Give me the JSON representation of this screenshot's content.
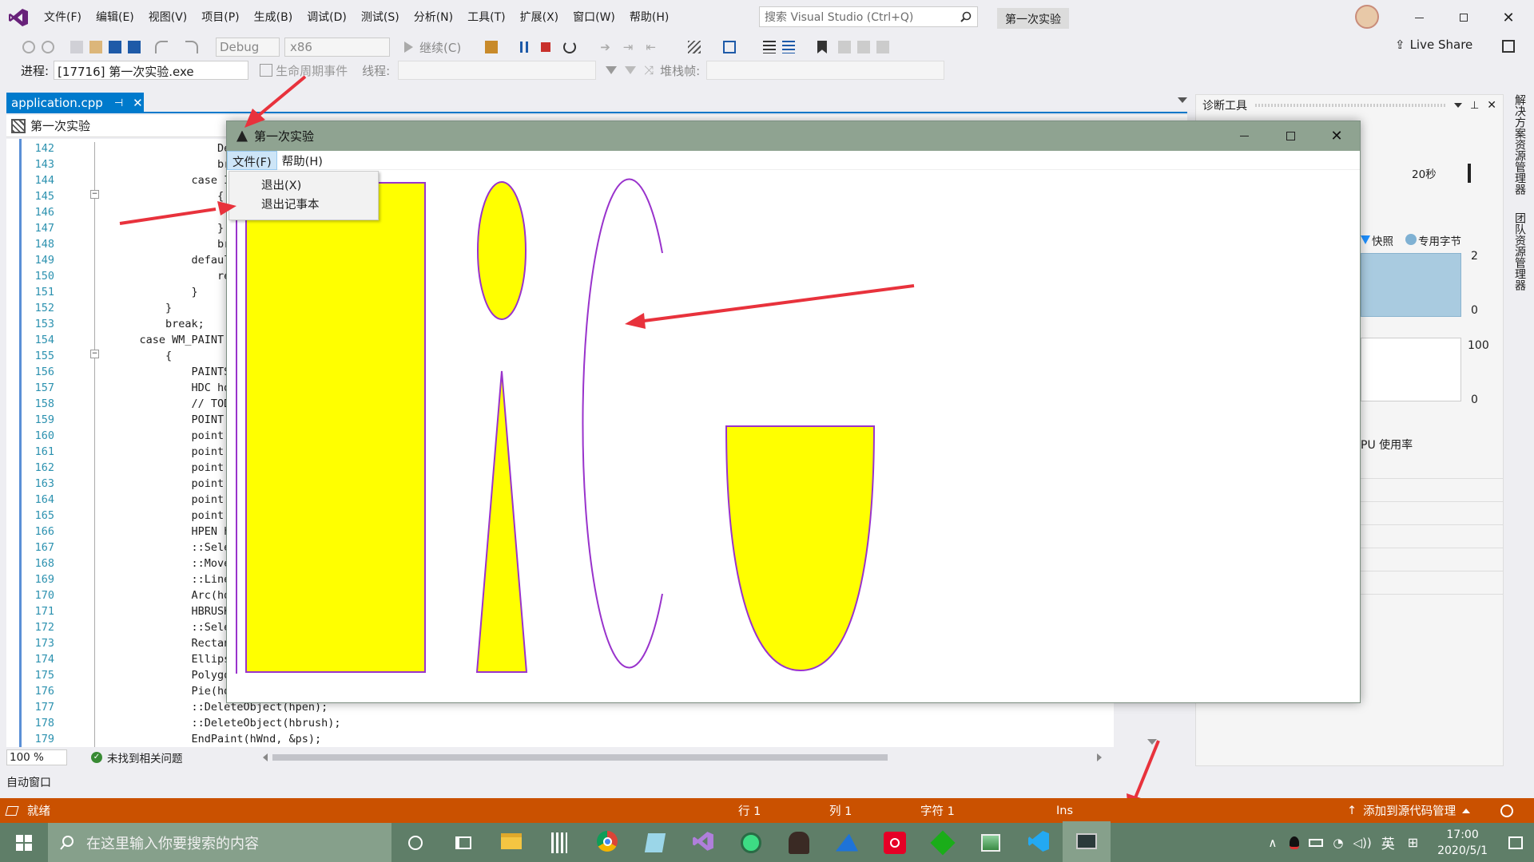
{
  "menu": [
    "文件(F)",
    "编辑(E)",
    "视图(V)",
    "项目(P)",
    "生成(B)",
    "调试(D)",
    "测试(S)",
    "分析(N)",
    "工具(T)",
    "扩展(X)",
    "窗口(W)",
    "帮助(H)"
  ],
  "search": {
    "placeholder": "搜索 Visual Studio (Ctrl+Q)"
  },
  "solution_name": "第一次实验",
  "live_share": "Live Share",
  "toolbar": {
    "config": "Debug",
    "platform": "x86",
    "continue": "继续(C)",
    "process_label": "进程:",
    "process_value": "[17716] 第一次实验.exe",
    "lifecycle": "生命周期事件",
    "thread_label": "线程:",
    "stack_label": "堆栈帧:"
  },
  "editor": {
    "tab": "application.cpp",
    "scope": "第一次实验",
    "zoom": "100 %",
    "issues": "未找到相关问题",
    "lines": [
      {
        "n": "142",
        "t": "                Destr"
      },
      {
        "n": "143",
        "t": "                break"
      },
      {
        "n": "144",
        "t": "            case IDM_"
      },
      {
        "n": "145",
        "t": "                {"
      },
      {
        "n": "146",
        "t": ""
      },
      {
        "n": "147",
        "t": "                }"
      },
      {
        "n": "148",
        "t": "                break"
      },
      {
        "n": "149",
        "t": "            default:"
      },
      {
        "n": "150",
        "t": "                retu"
      },
      {
        "n": "151",
        "t": "            }"
      },
      {
        "n": "152",
        "t": "        }"
      },
      {
        "n": "153",
        "t": "        break;"
      },
      {
        "n": "154",
        "t": "    case WM_PAINT:"
      },
      {
        "n": "155",
        "t": "        {"
      },
      {
        "n": "156",
        "t": "            PAINTSTRU"
      },
      {
        "n": "157",
        "t": "            HDC hdc ="
      },
      {
        "n": "158",
        "t": "            // TODO:"
      },
      {
        "n": "159",
        "t": "            POINT poi"
      },
      {
        "n": "160",
        "t": "            point[0]."
      },
      {
        "n": "161",
        "t": "            point[0]."
      },
      {
        "n": "162",
        "t": "            point[1]."
      },
      {
        "n": "163",
        "t": "            point[1]."
      },
      {
        "n": "164",
        "t": "            point[2]."
      },
      {
        "n": "165",
        "t": "            point[2]."
      },
      {
        "n": "166",
        "t": "            HPEN hpen"
      },
      {
        "n": "167",
        "t": "            ::Select("
      },
      {
        "n": "168",
        "t": "            ::MoveToE"
      },
      {
        "n": "169",
        "t": "            ::LineTo"
      },
      {
        "n": "170",
        "t": "            Arc(hdc,"
      },
      {
        "n": "171",
        "t": "            HBRUSH hb"
      },
      {
        "n": "172",
        "t": "            ::Select("
      },
      {
        "n": "173",
        "t": "            Rectangle"
      },
      {
        "n": "174",
        "t": "            Ellipse(h"
      },
      {
        "n": "175",
        "t": "            Polygon(h"
      },
      {
        "n": "176",
        "t": "            Pie(hdc,5"
      },
      {
        "n": "177",
        "t": "            ::DeleteObject(hpen);"
      },
      {
        "n": "178",
        "t": "            ::DeleteObject(hbrush);"
      },
      {
        "n": "179",
        "t": "            EndPaint(hWnd, &ps);"
      }
    ]
  },
  "auto_window": "自动窗口",
  "diag": {
    "title": "诊断工具",
    "time": "20秒",
    "snapshot": "快照",
    "private_bytes": "专用字节",
    "mem_max": "2",
    "mem_min": "0",
    "cpu_max": "100",
    "cpu_min": "0",
    "cpu_label": "PU 使用率"
  },
  "side_tabs": [
    "解决方案资源管理器",
    "团队资源管理器"
  ],
  "app": {
    "title": "第一次实验",
    "menu": [
      "文件(F)",
      "帮助(H)"
    ],
    "dropdown": [
      "退出(X)",
      "退出记事本"
    ]
  },
  "colors": {
    "shape_fill": "#ffff00",
    "shape_stroke": "#9933cc",
    "accent": "#68217a",
    "statusbar": "#ca5100",
    "arrow": "#e8323c"
  },
  "status": {
    "ready": "就绪",
    "row": "行 1",
    "col": "列 1",
    "char": "字符 1",
    "ins": "Ins",
    "source": "添加到源代码管理"
  },
  "taskbar": {
    "search": "在这里输入你要搜索的内容",
    "ime": "英",
    "time": "17:00",
    "date": "2020/5/1"
  }
}
